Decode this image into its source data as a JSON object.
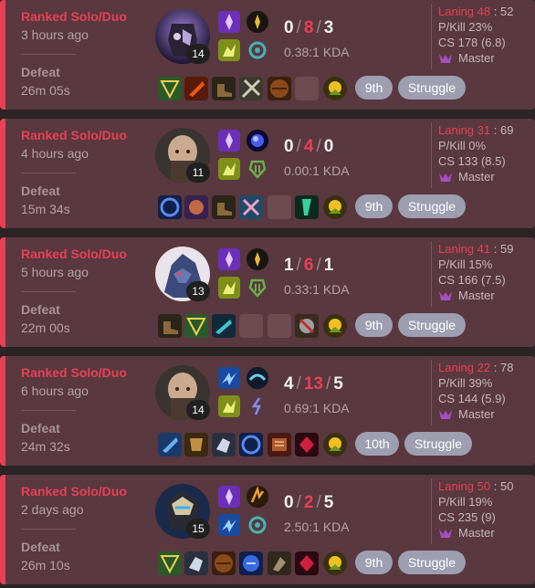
{
  "colors": {
    "loss": "#e84057",
    "card_bg": "#59383f",
    "page_bg": "#2b2326",
    "pill": "#9e9eb1"
  },
  "matches": [
    {
      "queue": "Ranked Solo/Duo",
      "ago": "3 hours ago",
      "result": "Defeat",
      "duration": "26m 05s",
      "champion_icon": "dark-armored-champion",
      "level": "14",
      "kills": "0",
      "deaths": "8",
      "assists": "3",
      "kda": "0.38:1 KDA",
      "spells": [
        "teleport-icon",
        "ghost-icon"
      ],
      "runes": [
        "conqueror-rune-icon",
        "resolve-rune-icon"
      ],
      "items": [
        "item",
        "item",
        "boots",
        "item",
        "item",
        "empty",
        "trinket"
      ],
      "place": "9th",
      "tag": "Struggle",
      "laning_label": "Laning",
      "laning": "48",
      "laning_opp": "52",
      "pkill": "P/Kill 23%",
      "cs": "CS 178 (6.8)",
      "tier": "Master"
    },
    {
      "queue": "Ranked Solo/Duo",
      "ago": "4 hours ago",
      "result": "Defeat",
      "duration": "15m 34s",
      "champion_icon": "bald-champion",
      "level": "11",
      "kills": "0",
      "deaths": "4",
      "assists": "0",
      "kda": "0.00:1 KDA",
      "spells": [
        "teleport-icon",
        "ghost-icon"
      ],
      "runes": [
        "electrocute-rune-icon",
        "resolve-rune-icon"
      ],
      "items": [
        "item",
        "item",
        "boots",
        "item",
        "empty",
        "item",
        "trinket"
      ],
      "place": "9th",
      "tag": "Struggle",
      "laning_label": "Laning",
      "laning": "31",
      "laning_opp": "69",
      "pkill": "P/Kill 0%",
      "cs": "CS 133 (8.5)",
      "tier": "Master"
    },
    {
      "queue": "Ranked Solo/Duo",
      "ago": "5 hours ago",
      "result": "Defeat",
      "duration": "22m 00s",
      "champion_icon": "blue-dragon-champion",
      "level": "13",
      "kills": "1",
      "deaths": "6",
      "assists": "1",
      "kda": "0.33:1 KDA",
      "spells": [
        "teleport-icon",
        "ghost-icon"
      ],
      "runes": [
        "conqueror-rune-icon",
        "resolve-rune-icon"
      ],
      "items": [
        "boots",
        "item",
        "item",
        "empty",
        "empty",
        "item",
        "trinket"
      ],
      "place": "9th",
      "tag": "Struggle",
      "laning_label": "Laning",
      "laning": "41",
      "laning_opp": "59",
      "pkill": "P/Kill 15%",
      "cs": "CS 166 (7.5)",
      "tier": "Master"
    },
    {
      "queue": "Ranked Solo/Duo",
      "ago": "6 hours ago",
      "result": "Defeat",
      "duration": "24m 32s",
      "champion_icon": "bald-champion",
      "level": "14",
      "kills": "4",
      "deaths": "13",
      "assists": "5",
      "kda": "0.69:1 KDA",
      "spells": [
        "flash-icon",
        "ghost-icon"
      ],
      "runes": [
        "hail-of-blades-rune-icon",
        "sorcery-rune-icon"
      ],
      "items": [
        "item",
        "item",
        "item",
        "item",
        "item",
        "item",
        "trinket"
      ],
      "place": "10th",
      "tag": "Struggle",
      "laning_label": "Laning",
      "laning": "22",
      "laning_opp": "78",
      "pkill": "P/Kill 39%",
      "cs": "CS 144 (5.9)",
      "tier": "Master"
    },
    {
      "queue": "Ranked Solo/Duo",
      "ago": "2 days ago",
      "result": "Defeat",
      "duration": "26m 10s",
      "champion_icon": "armored-knight-champion",
      "level": "15",
      "kills": "0",
      "deaths": "2",
      "assists": "5",
      "kda": "2.50:1 KDA",
      "spells": [
        "teleport-icon",
        "flash-icon"
      ],
      "runes": [
        "phase-rush-rune-icon",
        "resolve-rune-icon"
      ],
      "items": [
        "item",
        "item",
        "item",
        "item",
        "item",
        "item",
        "trinket"
      ],
      "place": "9th",
      "tag": "Struggle",
      "laning_label": "Laning",
      "laning": "50",
      "laning_opp": "50",
      "pkill": "P/Kill 19%",
      "cs": "CS 235 (9)",
      "tier": "Master"
    }
  ]
}
